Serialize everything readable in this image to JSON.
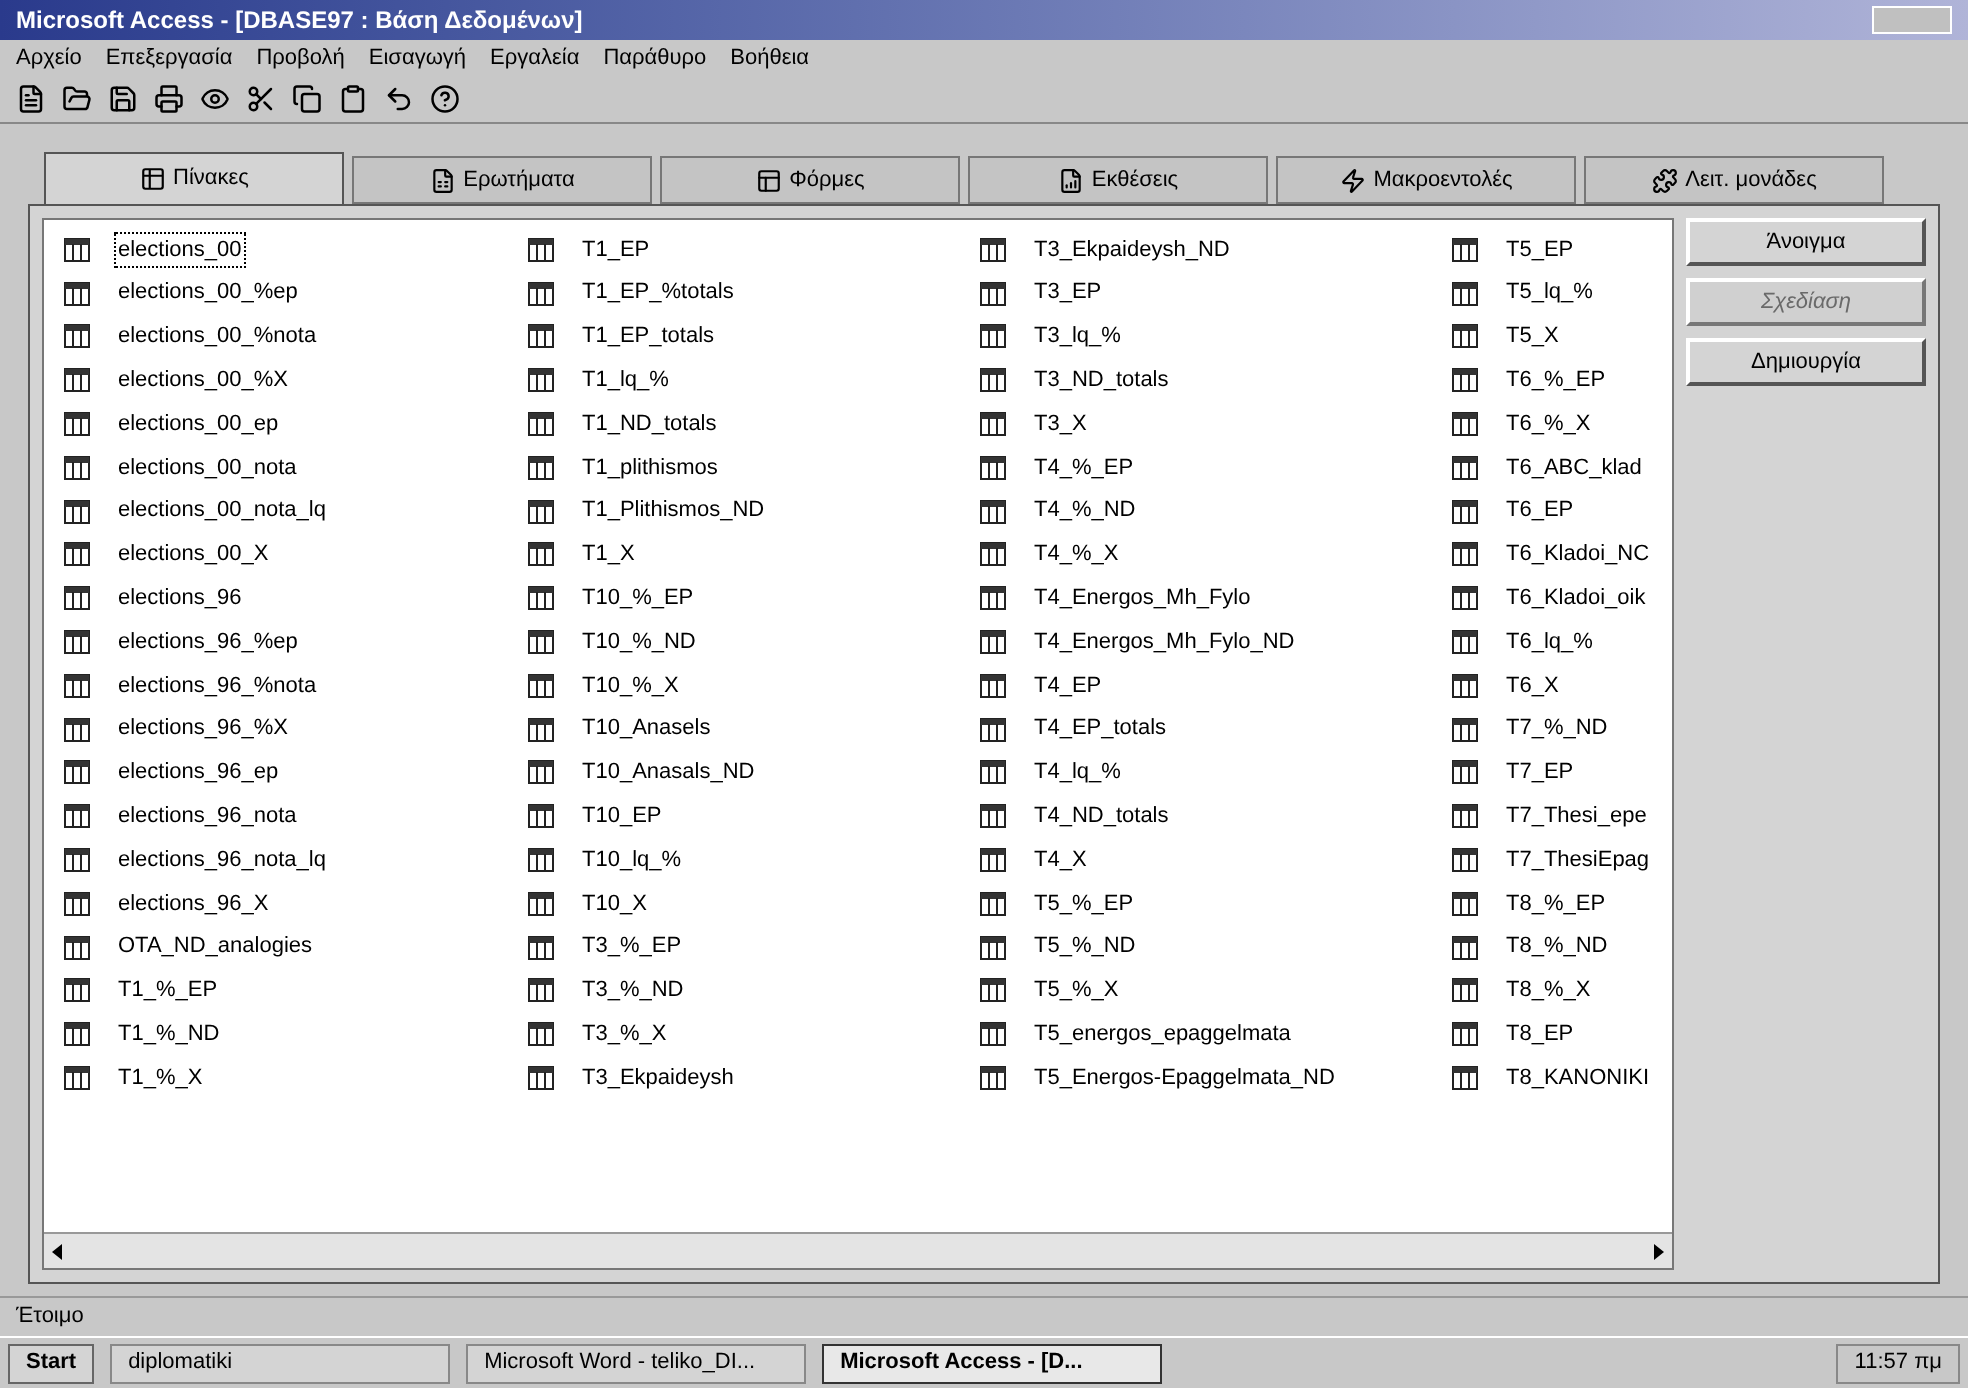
{
  "window": {
    "title": "Microsoft Access - [DBASE97 : Βάση Δεδομένων]"
  },
  "menu": [
    "Αρχείο",
    "Επεξεργασία",
    "Προβολή",
    "Εισαγωγή",
    "Εργαλεία",
    "Παράθυρο",
    "Βοήθεια"
  ],
  "tabs": [
    {
      "label": "Πίνακες",
      "selected": true
    },
    {
      "label": "Ερωτήματα",
      "selected": false
    },
    {
      "label": "Φόρμες",
      "selected": false
    },
    {
      "label": "Εκθέσεις",
      "selected": false
    },
    {
      "label": "Μακροεντολές",
      "selected": false
    },
    {
      "label": "Λειτ. μονάδες",
      "selected": false
    }
  ],
  "table_list": [
    {
      "items": [
        {
          "name": "elections_00",
          "selected": true
        },
        {
          "name": "elections_00_%ep",
          "selected": false
        },
        {
          "name": "elections_00_%nota",
          "selected": false
        },
        {
          "name": "elections_00_%X",
          "selected": false
        },
        {
          "name": "elections_00_ep",
          "selected": false
        },
        {
          "name": "elections_00_nota",
          "selected": false
        },
        {
          "name": "elections_00_nota_lq",
          "selected": false
        },
        {
          "name": "elections_00_X",
          "selected": false
        },
        {
          "name": "elections_96",
          "selected": false
        },
        {
          "name": "elections_96_%ep",
          "selected": false
        },
        {
          "name": "elections_96_%nota",
          "selected": false
        },
        {
          "name": "elections_96_%X",
          "selected": false
        },
        {
          "name": "elections_96_ep",
          "selected": false
        },
        {
          "name": "elections_96_nota",
          "selected": false
        },
        {
          "name": "elections_96_nota_lq",
          "selected": false
        },
        {
          "name": "elections_96_X",
          "selected": false
        },
        {
          "name": "OTA_ND_analogies",
          "selected": false
        },
        {
          "name": "T1_%_EP",
          "selected": false
        },
        {
          "name": "T1_%_ND",
          "selected": false
        },
        {
          "name": "T1_%_X",
          "selected": false
        }
      ]
    },
    {
      "items": [
        {
          "name": "T1_EP",
          "selected": false
        },
        {
          "name": "T1_EP_%totals",
          "selected": false
        },
        {
          "name": "T1_EP_totals",
          "selected": false
        },
        {
          "name": "T1_lq_%",
          "selected": false
        },
        {
          "name": "T1_ND_totals",
          "selected": false
        },
        {
          "name": "T1_plithismos",
          "selected": false
        },
        {
          "name": "T1_Plithismos_ND",
          "selected": false
        },
        {
          "name": "T1_X",
          "selected": false
        },
        {
          "name": "T10_%_EP",
          "selected": false
        },
        {
          "name": "T10_%_ND",
          "selected": false
        },
        {
          "name": "T10_%_X",
          "selected": false
        },
        {
          "name": "T10_Anasels",
          "selected": false
        },
        {
          "name": "T10_Anasals_ND",
          "selected": false
        },
        {
          "name": "T10_EP",
          "selected": false
        },
        {
          "name": "T10_lq_%",
          "selected": false
        },
        {
          "name": "T10_X",
          "selected": false
        },
        {
          "name": "T3_%_EP",
          "selected": false
        },
        {
          "name": "T3_%_ND",
          "selected": false
        },
        {
          "name": "T3_%_X",
          "selected": false
        },
        {
          "name": "T3_Ekpaideysh",
          "selected": false
        }
      ]
    },
    {
      "items": [
        {
          "name": "T3_Ekpaideysh_ND",
          "selected": false
        },
        {
          "name": "T3_EP",
          "selected": false
        },
        {
          "name": "T3_lq_%",
          "selected": false
        },
        {
          "name": "T3_ND_totals",
          "selected": false
        },
        {
          "name": "T3_X",
          "selected": false
        },
        {
          "name": "T4_%_EP",
          "selected": false
        },
        {
          "name": "T4_%_ND",
          "selected": false
        },
        {
          "name": "T4_%_X",
          "selected": false
        },
        {
          "name": "T4_Energos_Mh_Fylo",
          "selected": false
        },
        {
          "name": "T4_Energos_Mh_Fylo_ND",
          "selected": false
        },
        {
          "name": "T4_EP",
          "selected": false
        },
        {
          "name": "T4_EP_totals",
          "selected": false
        },
        {
          "name": "T4_lq_%",
          "selected": false
        },
        {
          "name": "T4_ND_totals",
          "selected": false
        },
        {
          "name": "T4_X",
          "selected": false
        },
        {
          "name": "T5_%_EP",
          "selected": false
        },
        {
          "name": "T5_%_ND",
          "selected": false
        },
        {
          "name": "T5_%_X",
          "selected": false
        },
        {
          "name": "T5_energos_epaggelmata",
          "selected": false
        },
        {
          "name": "T5_Energos-Epaggelmata_ND",
          "selected": false
        }
      ]
    },
    {
      "items": [
        {
          "name": "T5_EP",
          "selected": false
        },
        {
          "name": "T5_lq_%",
          "selected": false
        },
        {
          "name": "T5_X",
          "selected": false
        },
        {
          "name": "T6_%_EP",
          "selected": false
        },
        {
          "name": "T6_%_X",
          "selected": false
        },
        {
          "name": "T6_ABC_klad",
          "selected": false
        },
        {
          "name": "T6_EP",
          "selected": false
        },
        {
          "name": "T6_Kladoi_NC",
          "selected": false
        },
        {
          "name": "T6_Kladoi_oik",
          "selected": false
        },
        {
          "name": "T6_lq_%",
          "selected": false
        },
        {
          "name": "T6_X",
          "selected": false
        },
        {
          "name": "T7_%_ND",
          "selected": false
        },
        {
          "name": "T7_EP",
          "selected": false
        },
        {
          "name": "T7_Thesi_epe",
          "selected": false
        },
        {
          "name": "T7_ThesiEpag",
          "selected": false
        },
        {
          "name": "T8_%_EP",
          "selected": false
        },
        {
          "name": "T8_%_ND",
          "selected": false
        },
        {
          "name": "T8_%_X",
          "selected": false
        },
        {
          "name": "T8_EP",
          "selected": false
        },
        {
          "name": "T8_KANONIKI",
          "selected": false
        }
      ]
    }
  ],
  "buttons": [
    {
      "label": "Άνοιγμα",
      "disabled": false
    },
    {
      "label": "Σχεδίαση",
      "disabled": true
    },
    {
      "label": "Δημιουργία",
      "disabled": false
    }
  ],
  "status_bar": {
    "text": "Έτοιμο"
  },
  "taskbar": {
    "start": "Start",
    "items": [
      {
        "label": "diplomatiki",
        "selected": false
      },
      {
        "label": "Microsoft Word - teliko_DI...",
        "selected": false
      },
      {
        "label": "Microsoft Access - [D...",
        "selected": true
      }
    ],
    "clock": "11:57 πμ"
  }
}
